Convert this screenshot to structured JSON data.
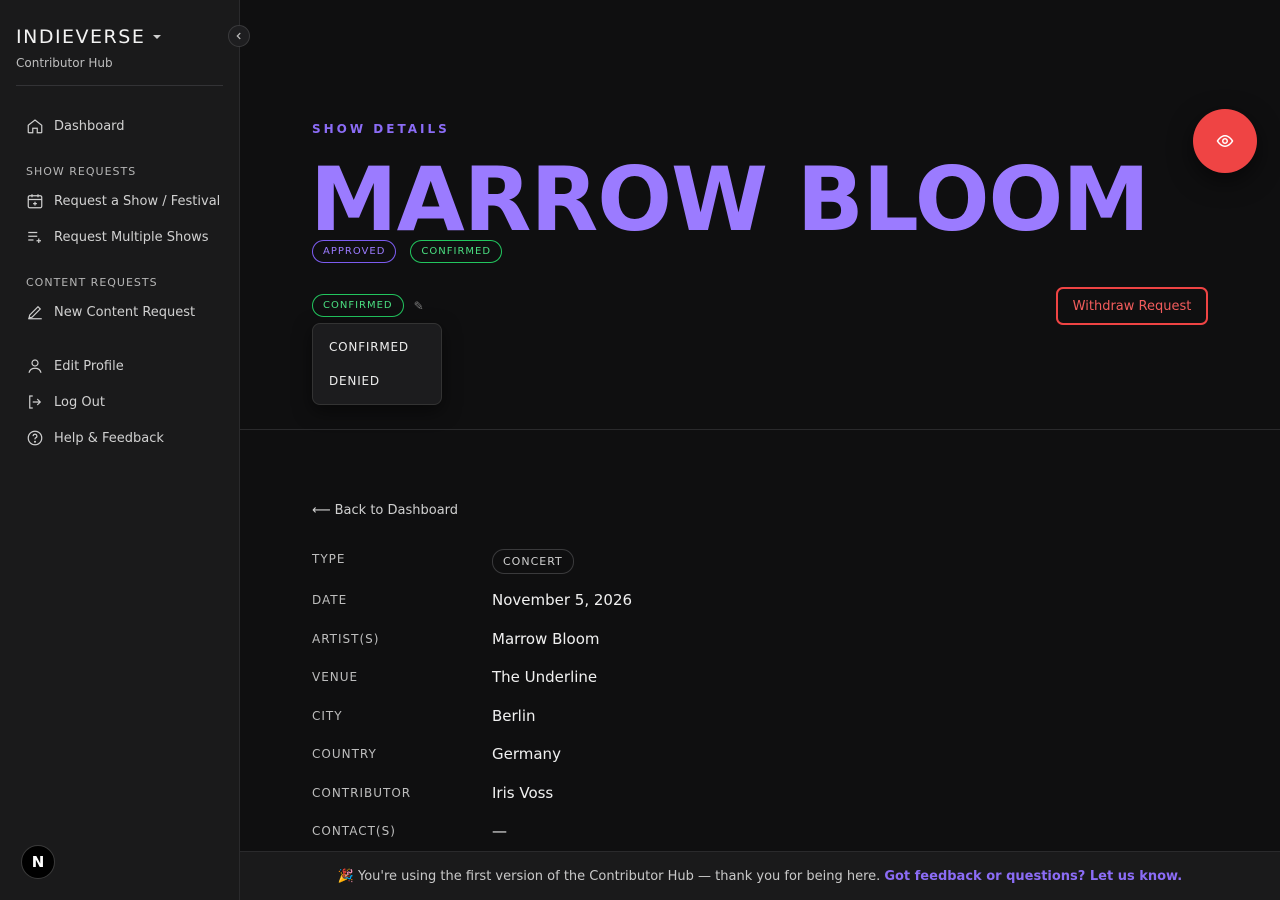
{
  "sidebar": {
    "brand_title": "INDIEVERSE",
    "brand_subtitle": "Contributor Hub",
    "dashboard": "Dashboard",
    "section_show_requests": "SHOW REQUESTS",
    "request_show": "Request a Show / Festival",
    "request_multiple": "Request Multiple Shows",
    "section_content_requests": "CONTENT REQUESTS",
    "new_content": "New Content Request",
    "edit_profile": "Edit Profile",
    "log_out": "Log Out",
    "help": "Help & Feedback",
    "next_badge": "N"
  },
  "header": {
    "eyebrow": "SHOW DETAILS",
    "title": "MARROW BLOOM",
    "badge_approved": "APPROVED",
    "badge_confirmed": "CONFIRMED",
    "status_value": "CONFIRMED",
    "dropdown_options": [
      "CONFIRMED",
      "DENIED"
    ],
    "withdraw_label": "Withdraw Request"
  },
  "details": {
    "back_label": "Back to Dashboard",
    "type_label": "TYPE",
    "type_value": "CONCERT",
    "date_label": "DATE",
    "date_value": "November 5, 2026",
    "artists_label": "ARTIST(S)",
    "artists_value": "Marrow Bloom",
    "venue_label": "VENUE",
    "venue_value": "The Underline",
    "city_label": "CITY",
    "city_value": "Berlin",
    "country_label": "COUNTRY",
    "country_value": "Germany",
    "contributor_label": "CONTRIBUTOR",
    "contributor_value": "Iris Voss",
    "contacts_label": "CONTACT(S)",
    "contacts_value": "—"
  },
  "footer": {
    "emoji": "🎉",
    "message": "You're using the first version of the Contributor Hub — thank you for being here.",
    "link": "Got feedback or questions? Let us know."
  },
  "colors": {
    "accent_purple": "#9b7bff",
    "confirmed_green": "#4ade80",
    "danger_red": "#ef4444",
    "background": "#0f0f10",
    "sidebar": "#1a1a1b"
  }
}
